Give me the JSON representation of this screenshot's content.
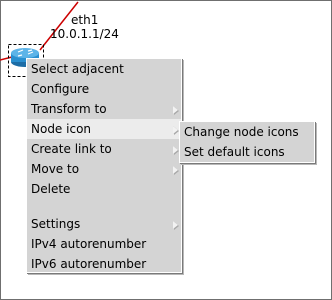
{
  "node": {
    "interface_name": "eth1",
    "interface_address": "10.0.1.1/24",
    "icon": "router-icon"
  },
  "context_menu": {
    "items": [
      {
        "label": "Select adjacent",
        "submenu": false
      },
      {
        "label": "Configure",
        "submenu": false
      },
      {
        "label": "Transform to",
        "submenu": true
      },
      {
        "label": "Node icon",
        "submenu": true,
        "active": true
      },
      {
        "label": "Create link to",
        "submenu": true
      },
      {
        "label": "Move to",
        "submenu": true
      },
      {
        "label": "Delete",
        "submenu": false
      },
      {
        "label": "Settings",
        "submenu": true
      },
      {
        "label": "IPv4 autorenumber",
        "submenu": false
      },
      {
        "label": "IPv6 autorenumber",
        "submenu": false
      }
    ]
  },
  "submenu": {
    "items": [
      {
        "label": "Change node icons"
      },
      {
        "label": "Set default icons"
      }
    ]
  },
  "colors": {
    "menu_bg": "#d4d4d4",
    "active_item_bg": "#ececec",
    "link_red": "#cc0000",
    "router_blue": "#2a8fd0"
  }
}
